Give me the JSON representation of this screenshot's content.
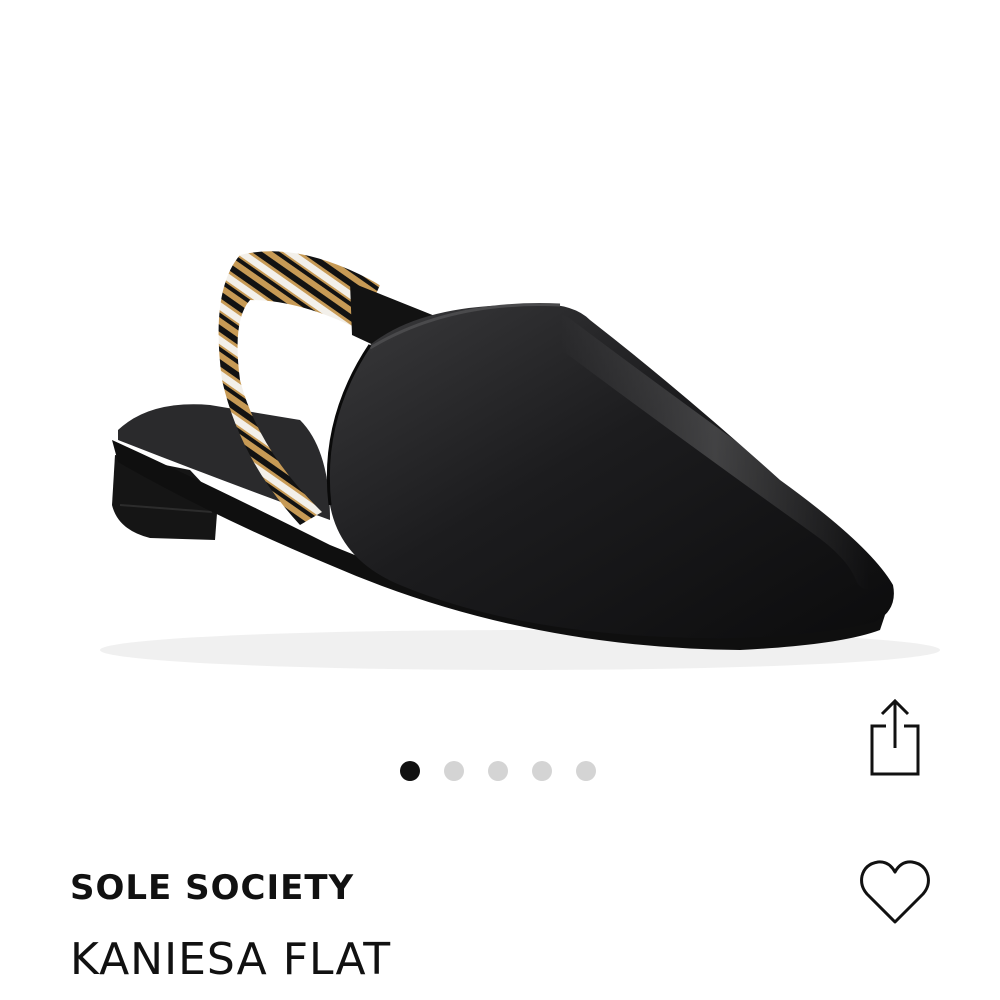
{
  "product": {
    "brand": "SOLE SOCIETY",
    "name": "KANIESA FLAT"
  },
  "gallery": {
    "total_images": 5,
    "active_index": 0
  },
  "icons": {
    "share": "share-icon",
    "favorite": "heart-icon"
  },
  "colors": {
    "text": "#111111",
    "dot_active": "#111111",
    "dot_inactive": "#d4d4d4",
    "shoe_leather": "#1a1a1a",
    "strap_gold": "#c79a55",
    "strap_white": "#f3f0ea"
  }
}
